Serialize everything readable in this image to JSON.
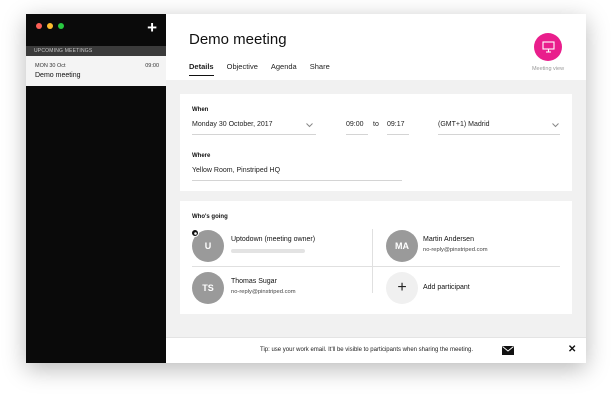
{
  "sidebar": {
    "section_label": "UPCOMING MEETINGS",
    "new_meeting_label": "+",
    "meetings": [
      {
        "date": "MON 30 Oct",
        "time": "09:00",
        "title": "Demo meeting"
      }
    ]
  },
  "header": {
    "title": "Demo meeting",
    "tabs": [
      {
        "label": "Details"
      },
      {
        "label": "Objective"
      },
      {
        "label": "Agenda"
      },
      {
        "label": "Share"
      }
    ],
    "meeting_view_label": "Meeting view"
  },
  "details": {
    "when_label": "When",
    "date_value": "Monday  30 October, 2017",
    "start_time": "09:00",
    "to_label": "to",
    "end_time": "09:17",
    "timezone": "(GMT+1) Madrid",
    "where_label": "Where",
    "location": "Yellow Room, Pinstriped HQ"
  },
  "participants": {
    "section_label": "Who's going",
    "people": [
      {
        "initials": "U",
        "name": "Uptodown (meeting owner)",
        "email": ""
      },
      {
        "initials": "MA",
        "name": "Martin Andersen",
        "email": "no-reply@pinstriped.com"
      },
      {
        "initials": "TS",
        "name": "Thomas Sugar",
        "email": "no-reply@pinstriped.com"
      }
    ],
    "add_symbol": "+",
    "add_label": "Add participant"
  },
  "tip": {
    "text": "Tip: use your work email. It'll be visible to participants when sharing the meeting.",
    "close_label": "✕"
  },
  "colors": {
    "accent": "#e91e8c",
    "sidebar_bg": "#0a0a0a",
    "avatar": "#9a9a9a",
    "traffic_red": "#fc5f57",
    "traffic_yellow": "#fdbc2e",
    "traffic_green": "#28c840"
  }
}
